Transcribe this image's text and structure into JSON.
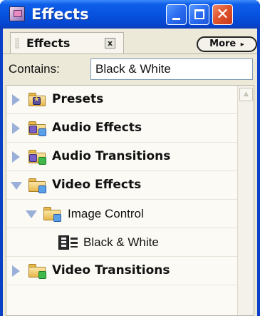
{
  "window": {
    "title": "Effects",
    "icon": "effects-app-icon"
  },
  "titlebar_buttons": {
    "minimize": "minimize-icon",
    "maximize": "maximize-icon",
    "close": "✕"
  },
  "panel": {
    "tab_label": "Effects",
    "tab_close": "x",
    "more_label": "More",
    "more_arrow": "▸"
  },
  "filter": {
    "label": "Contains:",
    "value": "Black & White"
  },
  "tree": {
    "items": [
      {
        "label": "Presets",
        "icon": "presets-folder-icon",
        "expanded": false,
        "level": 0
      },
      {
        "label": "Audio Effects",
        "icon": "audio-effects-folder-icon",
        "expanded": false,
        "level": 0
      },
      {
        "label": "Audio Transitions",
        "icon": "audio-transitions-folder-icon",
        "expanded": false,
        "level": 0
      },
      {
        "label": "Video Effects",
        "icon": "video-effects-folder-icon",
        "expanded": true,
        "level": 0
      },
      {
        "label": "Image Control",
        "icon": "folder-icon",
        "expanded": true,
        "level": 1
      },
      {
        "label": "Black & White",
        "icon": "video-effect-icon",
        "level": 2
      },
      {
        "label": "Video Transitions",
        "icon": "video-transitions-folder-icon",
        "expanded": false,
        "level": 0
      }
    ]
  },
  "colors": {
    "titlebar": "#0753e0",
    "close_button": "#e0552d",
    "panel_bg": "#ece9d8",
    "expander": "#9ab0d8"
  }
}
